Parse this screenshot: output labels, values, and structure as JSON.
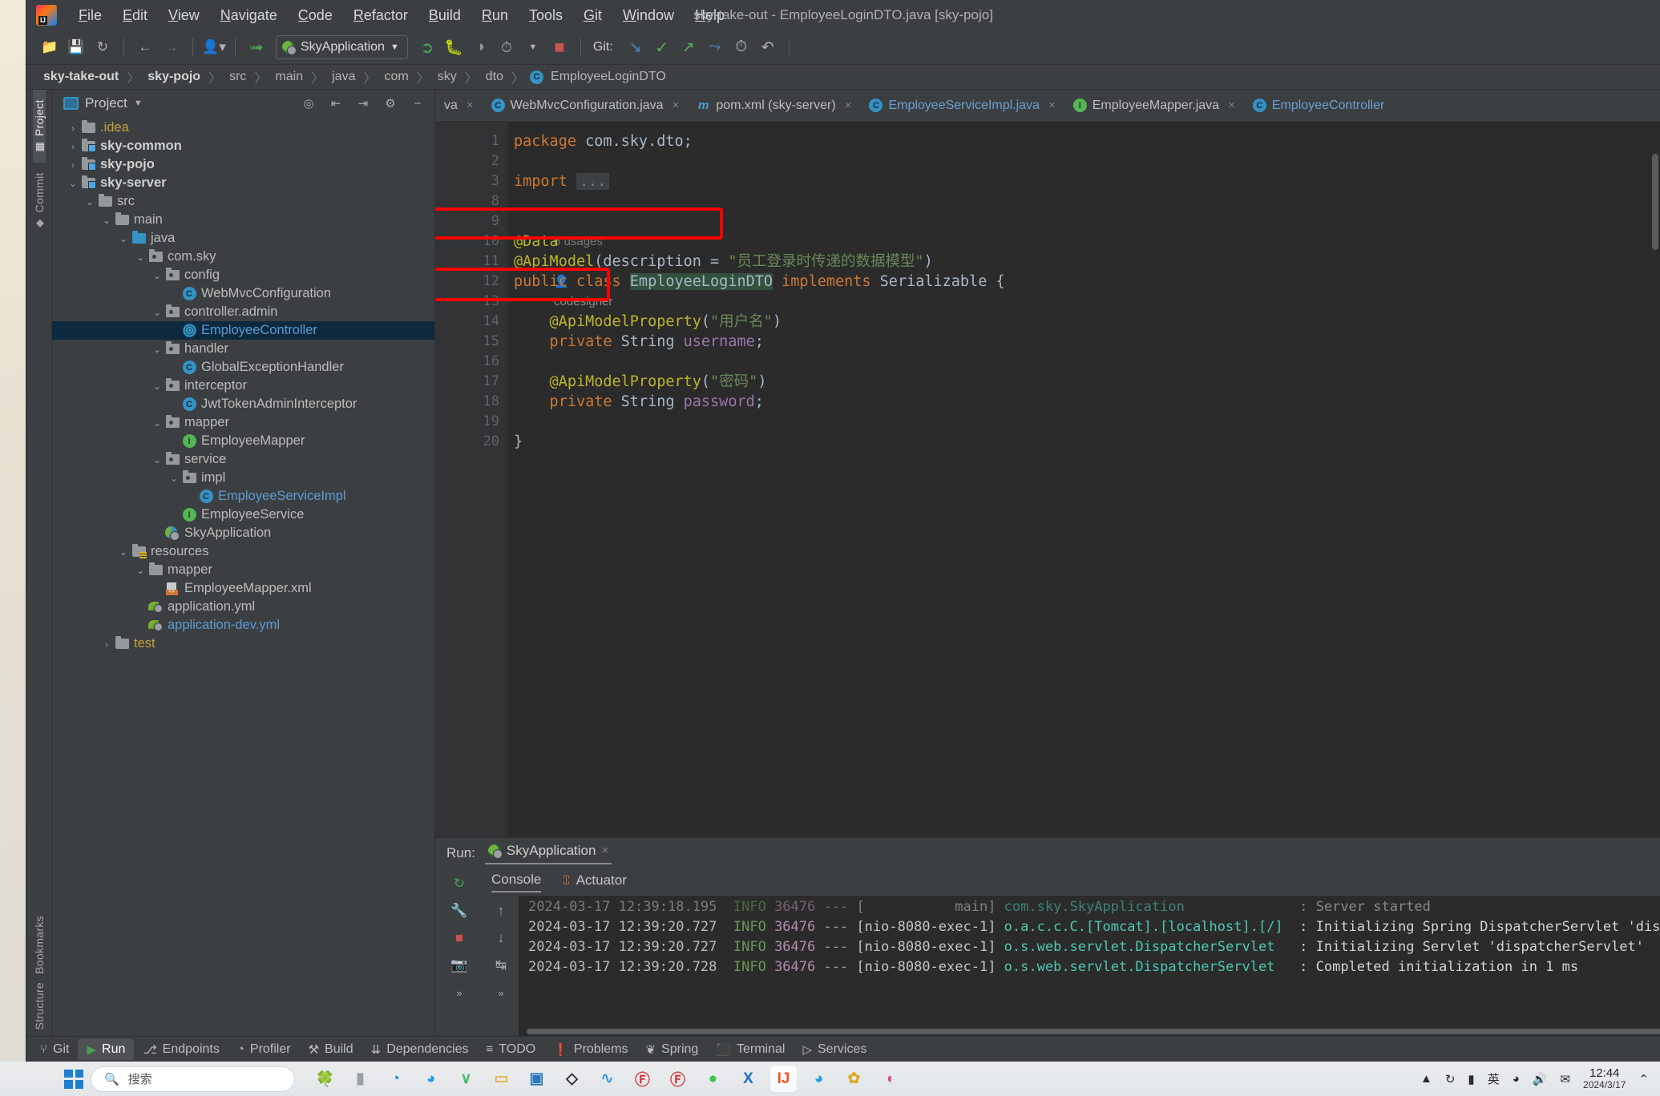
{
  "window": {
    "title": "sky-take-out - EmployeeLoginDTO.java [sky-pojo]"
  },
  "menu": {
    "items": [
      "File",
      "Edit",
      "View",
      "Navigate",
      "Code",
      "Refactor",
      "Build",
      "Run",
      "Tools",
      "Git",
      "Window",
      "Help"
    ]
  },
  "toolbar": {
    "open_icon": "folder-open-icon",
    "save_icon": "save-icon",
    "sync_icon": "refresh-icon",
    "back_icon": "arrow-left-icon",
    "forward_icon": "arrow-right-icon",
    "profile_icon": "user-dropdown-icon",
    "build_icon": "hammer-icon",
    "run_config": "SkyApplication",
    "run_icon": "run-icon",
    "debug_icon": "debug-icon",
    "run_coverage_icon": "run-with-coverage-icon",
    "profile_run_icon": "profiler-run-icon",
    "stop_icon": "stop-icon",
    "git_label": "Git:",
    "git_update_icon": "git-update-icon",
    "git_commit_icon": "git-commit-check-icon",
    "git_push_icon": "git-push-icon",
    "git_branch_icon": "git-branch-icon",
    "history_icon": "history-icon",
    "rollback_icon": "rollback-icon"
  },
  "breadcrumb": {
    "items": [
      {
        "label": "sky-take-out",
        "bold": true
      },
      {
        "label": "sky-pojo",
        "bold": true
      },
      {
        "label": "src",
        "bold": false
      },
      {
        "label": "main",
        "bold": false
      },
      {
        "label": "java",
        "bold": false
      },
      {
        "label": "com",
        "bold": false
      },
      {
        "label": "sky",
        "bold": false
      },
      {
        "label": "dto",
        "bold": false
      }
    ],
    "file": "EmployeeLoginDTO",
    "file_icon": "class-icon",
    "separator": "〉"
  },
  "left_strip": {
    "project_tab": "Project",
    "commit_tab": "Commit",
    "bookmarks_tab": "Bookmarks",
    "structure_tab": "Structure"
  },
  "project_panel": {
    "title": "Project",
    "dropdown_icon": "chevron-down-icon",
    "locate_icon": "target-icon",
    "expand_icon": "expand-all-icon",
    "collapse_icon": "collapse-all-icon",
    "settings_icon": "gear-icon",
    "hide_icon": "minimize-icon",
    "tree": [
      {
        "label": ".idea",
        "indent": 1,
        "arrow": "›",
        "icon": "folder",
        "style": "yellow"
      },
      {
        "label": "sky-common",
        "indent": 1,
        "arrow": "›",
        "icon": "folder-module",
        "style": "bold"
      },
      {
        "label": "sky-pojo",
        "indent": 1,
        "arrow": "›",
        "icon": "folder-module",
        "style": "bold"
      },
      {
        "label": "sky-server",
        "indent": 1,
        "arrow": "⌄",
        "icon": "folder-module",
        "style": "bold"
      },
      {
        "label": "src",
        "indent": 2,
        "arrow": "⌄",
        "icon": "folder",
        "style": ""
      },
      {
        "label": "main",
        "indent": 3,
        "arrow": "⌄",
        "icon": "folder",
        "style": ""
      },
      {
        "label": "java",
        "indent": 4,
        "arrow": "⌄",
        "icon": "folder-source",
        "style": ""
      },
      {
        "label": "com.sky",
        "indent": 5,
        "arrow": "⌄",
        "icon": "package",
        "style": ""
      },
      {
        "label": "config",
        "indent": 6,
        "arrow": "⌄",
        "icon": "package",
        "style": ""
      },
      {
        "label": "WebMvcConfiguration",
        "indent": 7,
        "arrow": "",
        "icon": "class",
        "style": ""
      },
      {
        "label": "controller.admin",
        "indent": 6,
        "arrow": "⌄",
        "icon": "package",
        "style": ""
      },
      {
        "label": "EmployeeController",
        "indent": 7,
        "arrow": "",
        "icon": "controller",
        "style": "blue",
        "selected": true
      },
      {
        "label": "handler",
        "indent": 6,
        "arrow": "⌄",
        "icon": "package",
        "style": ""
      },
      {
        "label": "GlobalExceptionHandler",
        "indent": 7,
        "arrow": "",
        "icon": "class",
        "style": ""
      },
      {
        "label": "interceptor",
        "indent": 6,
        "arrow": "⌄",
        "icon": "package",
        "style": ""
      },
      {
        "label": "JwtTokenAdminInterceptor",
        "indent": 7,
        "arrow": "",
        "icon": "class",
        "style": ""
      },
      {
        "label": "mapper",
        "indent": 6,
        "arrow": "⌄",
        "icon": "package",
        "style": ""
      },
      {
        "label": "EmployeeMapper",
        "indent": 7,
        "arrow": "",
        "icon": "interface",
        "style": ""
      },
      {
        "label": "service",
        "indent": 6,
        "arrow": "⌄",
        "icon": "package",
        "style": ""
      },
      {
        "label": "impl",
        "indent": 7,
        "arrow": "⌄",
        "icon": "package",
        "style": ""
      },
      {
        "label": "EmployeeServiceImpl",
        "indent": 8,
        "arrow": "",
        "icon": "class",
        "style": "blue"
      },
      {
        "label": "EmployeeService",
        "indent": 7,
        "arrow": "",
        "icon": "interface",
        "style": ""
      },
      {
        "label": "SkyApplication",
        "indent": 6,
        "arrow": "",
        "icon": "spring-app",
        "style": ""
      },
      {
        "label": "resources",
        "indent": 4,
        "arrow": "⌄",
        "icon": "folder-res",
        "style": ""
      },
      {
        "label": "mapper",
        "indent": 5,
        "arrow": "⌄",
        "icon": "folder",
        "style": ""
      },
      {
        "label": "EmployeeMapper.xml",
        "indent": 6,
        "arrow": "",
        "icon": "xml",
        "style": ""
      },
      {
        "label": "application.yml",
        "indent": 5,
        "arrow": "",
        "icon": "yml",
        "style": ""
      },
      {
        "label": "application-dev.yml",
        "indent": 5,
        "arrow": "",
        "icon": "yml",
        "style": "blue"
      },
      {
        "label": "test",
        "indent": 3,
        "arrow": "›",
        "icon": "folder",
        "style": "yellow"
      }
    ]
  },
  "editor_tabs": [
    {
      "label": "va",
      "icon": "none",
      "color": "plain",
      "close": "×"
    },
    {
      "label": "WebMvcConfiguration.java",
      "icon": "class",
      "color": "plain",
      "close": "×"
    },
    {
      "label": "pom.xml (sky-server)",
      "icon": "maven",
      "color": "plain",
      "close": "×"
    },
    {
      "label": "EmployeeServiceImpl.java",
      "icon": "class",
      "color": "blue",
      "close": "×"
    },
    {
      "label": "EmployeeMapper.java",
      "icon": "interface",
      "color": "plain",
      "close": "×"
    },
    {
      "label": "EmployeeController",
      "icon": "class",
      "color": "blue",
      "close": ""
    }
  ],
  "editor": {
    "line_numbers": [
      "1",
      "2",
      "3",
      "8",
      "9",
      "10",
      "11",
      "12",
      "13",
      "14",
      "15",
      "16",
      "17",
      "18",
      "19",
      "20"
    ],
    "inlay_usages": "6 usages",
    "inlay_author": "codesigner",
    "author_icon": "person-icon",
    "code_lines": [
      {
        "n": "1",
        "segs": [
          {
            "t": "package ",
            "c": "kw"
          },
          {
            "t": "com.sky.dto;",
            "c": "pkgn"
          }
        ]
      },
      {
        "n": "2",
        "segs": []
      },
      {
        "n": "3",
        "segs": [
          {
            "t": "import ",
            "c": "kw"
          },
          {
            "t": "...",
            "c": "imp-dots"
          }
        ]
      },
      {
        "n": "8",
        "segs": []
      },
      {
        "n": "9",
        "segs": [
          {
            "t": "@Data",
            "c": "ann"
          }
        ]
      },
      {
        "n": "10",
        "segs": [
          {
            "t": "@ApiModel",
            "c": "ann"
          },
          {
            "t": "(description = ",
            "c": "punc"
          },
          {
            "t": "\"员工登录时传递的数据模型\"",
            "c": "str"
          },
          {
            "t": ")",
            "c": "punc"
          }
        ]
      },
      {
        "n": "11",
        "segs": [
          {
            "t": "public ",
            "c": "kw"
          },
          {
            "t": "class ",
            "c": "kw"
          },
          {
            "t": "EmployeeLoginDTO",
            "c": "sel-ident"
          },
          {
            "t": " implements ",
            "c": "kw"
          },
          {
            "t": "Serializable",
            "c": "typ"
          },
          {
            "t": " {",
            "c": "punc"
          }
        ]
      },
      {
        "n": "12",
        "segs": []
      },
      {
        "n": "13",
        "segs": [
          {
            "t": "    @ApiModelProperty",
            "c": "ann"
          },
          {
            "t": "(",
            "c": "punc"
          },
          {
            "t": "\"用户名\"",
            "c": "str"
          },
          {
            "t": ")",
            "c": "punc"
          }
        ]
      },
      {
        "n": "14",
        "segs": [
          {
            "t": "    private ",
            "c": "kw"
          },
          {
            "t": "String ",
            "c": "typ"
          },
          {
            "t": "username",
            "c": "fld"
          },
          {
            "t": ";",
            "c": "punc"
          }
        ]
      },
      {
        "n": "15",
        "segs": []
      },
      {
        "n": "16",
        "segs": [
          {
            "t": "    @ApiModelProperty",
            "c": "ann"
          },
          {
            "t": "(",
            "c": "punc"
          },
          {
            "t": "\"密码\"",
            "c": "str"
          },
          {
            "t": ")",
            "c": "punc"
          }
        ]
      },
      {
        "n": "17",
        "segs": [
          {
            "t": "    private ",
            "c": "kw"
          },
          {
            "t": "String ",
            "c": "typ"
          },
          {
            "t": "password",
            "c": "fld"
          },
          {
            "t": ";",
            "c": "punc"
          }
        ]
      },
      {
        "n": "18",
        "segs": []
      },
      {
        "n": "19",
        "segs": [
          {
            "t": "}",
            "c": "punc"
          }
        ]
      },
      {
        "n": "20",
        "segs": []
      }
    ],
    "annotation_color": "#ff0000",
    "highlights": [
      {
        "name": "apimodel-highlight",
        "label": "@ApiModel(description = \"员工登录时传递的数据模型\")"
      },
      {
        "name": "apimodelproperty-highlight",
        "label": "@ApiModelProperty(\"用户名\")"
      }
    ]
  },
  "run_panel": {
    "run_label": "Run:",
    "config_name": "SkyApplication",
    "config_icon": "spring-leaf-icon",
    "close_icon": "×",
    "subtabs": [
      {
        "label": "Console",
        "icon": "console-icon",
        "active": true
      },
      {
        "label": "Actuator",
        "icon": "actuator-icon",
        "active": false
      }
    ],
    "side_buttons": [
      "rerun-icon",
      "stop-icon",
      "wrench-icon",
      "camera-icon"
    ],
    "side_buttons2": [
      "scroll-up-icon",
      "scroll-down-icon",
      "soft-wrap-icon"
    ],
    "console_lines": [
      {
        "time": "2024-03-17 12:39:18.195",
        "level": "INFO",
        "pid": "36476",
        "sep": "---",
        "thread": "[           main]",
        "logger": "com.sky.SkyApplication",
        "msg": ": Server started"
      },
      {
        "time": "2024-03-17 12:39:20.727",
        "level": "INFO",
        "pid": "36476",
        "sep": "---",
        "thread": "[nio-8080-exec-1]",
        "logger": "o.a.c.c.C.[Tomcat].[localhost].[/]",
        "msg": ": Initializing Spring DispatcherServlet 'dispatcherServlet'"
      },
      {
        "time": "2024-03-17 12:39:20.727",
        "level": "INFO",
        "pid": "36476",
        "sep": "---",
        "thread": "[nio-8080-exec-1]",
        "logger": "o.s.web.servlet.DispatcherServlet",
        "msg": ": Initializing Servlet 'dispatcherServlet'"
      },
      {
        "time": "2024-03-17 12:39:20.728",
        "level": "INFO",
        "pid": "36476",
        "sep": "---",
        "thread": "[nio-8080-exec-1]",
        "logger": "o.s.web.servlet.DispatcherServlet",
        "msg": ": Completed initialization in 1 ms"
      }
    ]
  },
  "status_tools": [
    {
      "label": "Git",
      "icon": "git-icon",
      "active": false
    },
    {
      "label": "Run",
      "icon": "run-icon",
      "active": true
    },
    {
      "label": "Endpoints",
      "icon": "endpoints-icon",
      "active": false
    },
    {
      "label": "Profiler",
      "icon": "profiler-icon",
      "active": false
    },
    {
      "label": "Build",
      "icon": "build-icon",
      "active": false
    },
    {
      "label": "Dependencies",
      "icon": "dependencies-icon",
      "active": false
    },
    {
      "label": "TODO",
      "icon": "todo-icon",
      "active": false
    },
    {
      "label": "Problems",
      "icon": "problems-icon",
      "active": false
    },
    {
      "label": "Spring",
      "icon": "spring-icon",
      "active": false
    },
    {
      "label": "Terminal",
      "icon": "terminal-icon",
      "active": false
    },
    {
      "label": "Services",
      "icon": "services-icon",
      "active": false
    }
  ],
  "taskbar": {
    "start_icon": "windows-start-icon",
    "search_placeholder": "搜索",
    "search_icon": "search-icon",
    "apps": [
      {
        "name": "clover-icon",
        "glyph": "🍀",
        "active": false
      },
      {
        "name": "file-explorer-icon",
        "glyph": "▮",
        "active": false
      },
      {
        "name": "edge-icon",
        "glyph": "◔",
        "active": false
      },
      {
        "name": "browser-icon",
        "glyph": "◕",
        "active": false
      },
      {
        "name": "wps-icon",
        "glyph": "∨",
        "active": false
      },
      {
        "name": "folder-icon",
        "glyph": "▭",
        "active": false
      },
      {
        "name": "store-icon",
        "glyph": "▣",
        "active": false
      },
      {
        "name": "dark-app-icon",
        "glyph": "◇",
        "active": false
      },
      {
        "name": "network-icon",
        "glyph": "∿",
        "active": false
      },
      {
        "name": "netease-icon",
        "glyph": "Ⓕ",
        "active": false
      },
      {
        "name": "red-app-icon",
        "glyph": "Ⓕ",
        "active": false
      },
      {
        "name": "wechat-icon",
        "glyph": "●",
        "active": false
      },
      {
        "name": "xmind-icon",
        "glyph": "X",
        "active": false
      },
      {
        "name": "intellij-icon",
        "glyph": "IJ",
        "active": true
      },
      {
        "name": "browser2-icon",
        "glyph": "◕",
        "active": false
      },
      {
        "name": "gold-app-icon",
        "glyph": "✿",
        "active": false
      },
      {
        "name": "pink-app-icon",
        "glyph": "◖",
        "active": false
      }
    ],
    "tray": [
      "chevron-up-icon",
      "sync-icon",
      "battery-icon",
      "ime-icon",
      "wifi-icon",
      "volume-icon",
      "notification-icon"
    ],
    "clock_time": "12:44",
    "clock_date": "2024/3/17"
  }
}
